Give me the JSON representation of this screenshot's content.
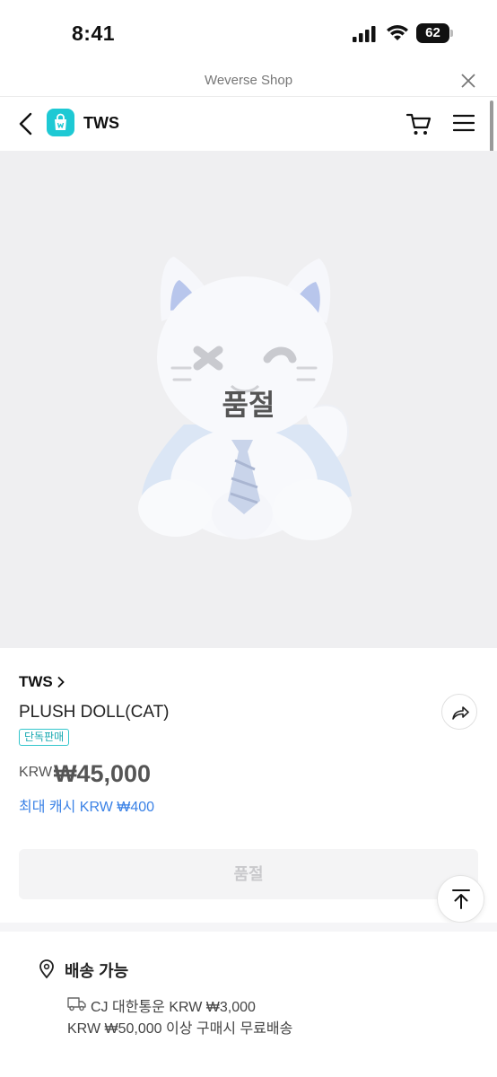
{
  "status_bar": {
    "time": "8:41",
    "battery": "62"
  },
  "webview": {
    "title": "Weverse Shop"
  },
  "header": {
    "shop_name": "TWS"
  },
  "product": {
    "image_overlay": "품절",
    "brand": "TWS",
    "name": "PLUSH DOLL(CAT)",
    "badge": "단독판매",
    "currency": "KRW",
    "price": "₩45,000",
    "cash": "최대 캐시 KRW ₩400",
    "buy_button": "품절"
  },
  "shipping": {
    "title": "배송 가능",
    "carrier": "CJ 대한통운 KRW ₩3,000",
    "free_condition": "KRW ₩50,000 이상 구매시 무료배송"
  },
  "colors": {
    "accent": "#1ec9d4",
    "link": "#3b82e6",
    "badge": "#17a8b0"
  }
}
